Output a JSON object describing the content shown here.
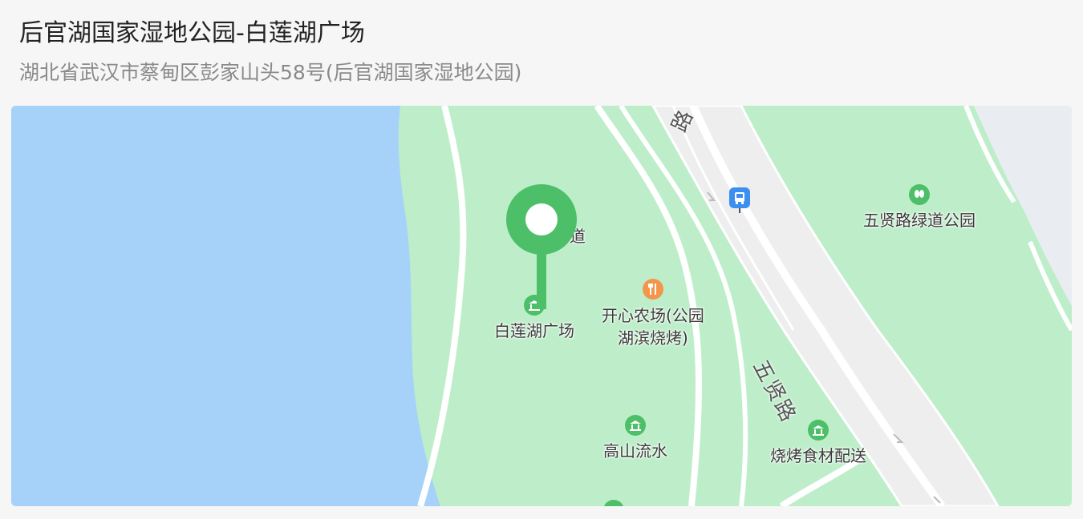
{
  "header": {
    "title": "后官湖国家湿地公园-白莲湖广场",
    "address": "湖北省武汉市蔡甸区彭家山头58号(后官湖国家湿地公园)"
  },
  "map": {
    "colors": {
      "water": "#a6d2fa",
      "park": "#bdeec9",
      "road": "#ffffff",
      "road_fill": "#eeeeee",
      "urban": "#e9edf2",
      "pin": "#4cbf68",
      "poi_green": "#4cbf68",
      "poi_orange": "#f3964c",
      "bus_blue": "#3b8ff0"
    },
    "pois": [
      {
        "label": "绿道",
        "icon": "none",
        "partial": true
      },
      {
        "label": "白莲湖广场",
        "icon": "scenic-icon"
      },
      {
        "label": "开心农场(公园\n湖滨烧烤)",
        "icon": "restaurant-icon"
      },
      {
        "label": "五贤路绿道公园",
        "icon": "park-icon"
      },
      {
        "label": "高山流水",
        "icon": "scenic-icon"
      },
      {
        "label": "烧烤食材配送",
        "icon": "scenic-icon"
      }
    ],
    "roads": [
      {
        "label": "五贤路"
      },
      {
        "label": "路"
      }
    ],
    "bus_stop_icon": "bus-stop-icon",
    "location_pin_icon": "location-pin-icon"
  }
}
